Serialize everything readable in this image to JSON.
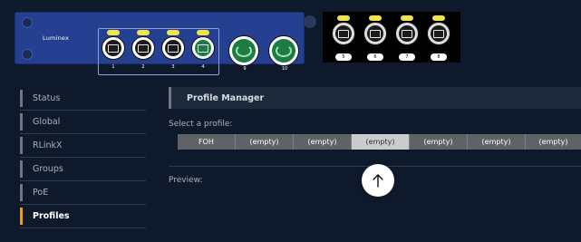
{
  "device": {
    "brand": "Luminex",
    "rj45_ports": [
      {
        "label": "1",
        "link": "active"
      },
      {
        "label": "2",
        "link": "active"
      },
      {
        "label": "3",
        "link": "active"
      },
      {
        "label": "4",
        "link": "green"
      }
    ],
    "sfp_ports": [
      {
        "label": "9"
      },
      {
        "label": "10"
      }
    ],
    "rear_ports": [
      {
        "label": "5"
      },
      {
        "label": "6"
      },
      {
        "label": "7"
      },
      {
        "label": "8"
      }
    ],
    "colors": {
      "chassis": "#253f91",
      "led": "#f2e34a",
      "link_green": "#1c7c43"
    }
  },
  "sidebar": {
    "items": [
      {
        "label": "Status",
        "active": false
      },
      {
        "label": "Global",
        "active": false
      },
      {
        "label": "RLinkX",
        "active": false
      },
      {
        "label": "Groups",
        "active": false
      },
      {
        "label": "PoE",
        "active": false
      },
      {
        "label": "Profiles",
        "active": true
      }
    ],
    "active_color": "#f29a1f"
  },
  "main": {
    "title": "Profile Manager",
    "select_label": "Select a profile:",
    "profiles": [
      {
        "label": "FOH",
        "selected": false
      },
      {
        "label": "(empty)",
        "selected": false
      },
      {
        "label": "(empty)",
        "selected": false
      },
      {
        "label": "(empty)",
        "selected": true
      },
      {
        "label": "(empty)",
        "selected": false
      },
      {
        "label": "(empty)",
        "selected": false
      },
      {
        "label": "(empty)",
        "selected": false
      }
    ],
    "preview_label": "Preview:"
  },
  "scroll_top_icon": "arrow-up-icon"
}
